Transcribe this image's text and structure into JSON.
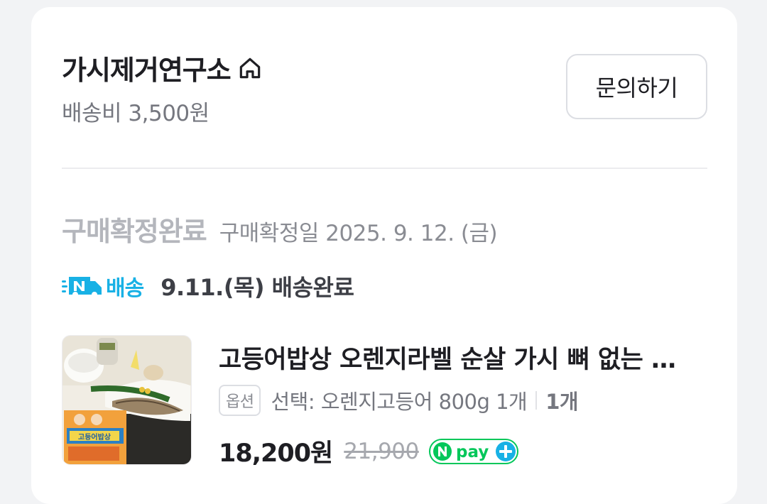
{
  "store": {
    "name": "가시제거연구소",
    "shipping_fee": "배송비 3,500원",
    "inquiry_label": "문의하기"
  },
  "order": {
    "status": "구매확정완료",
    "confirm_date": "구매확정일 2025. 9. 12. (금)",
    "delivery_badge": "배송",
    "delivery_status": "9.11.(목) 배송완료"
  },
  "product": {
    "title": "고등어밥상 오렌지라벨 순살 가시 뼈 없는 고등어",
    "option_badge": "옵션",
    "option_text": "선택: 오렌지고등어 800g 1개",
    "quantity": "1개",
    "price": "18,200원",
    "original_price": "21,900",
    "npay_label": "pay",
    "thumb_label": "고등어밥상"
  },
  "colors": {
    "accent_blue": "#18b1e5",
    "npay_green": "#03c75a"
  }
}
